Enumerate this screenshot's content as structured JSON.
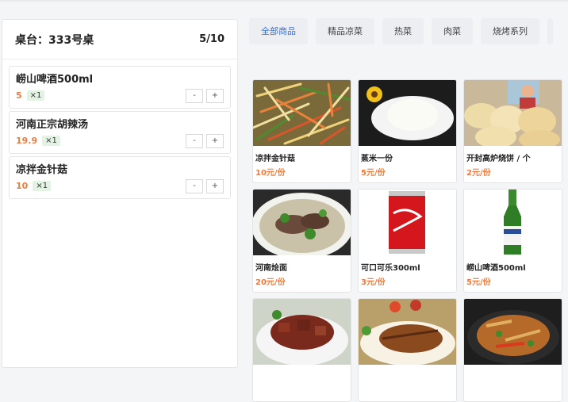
{
  "table": {
    "label": "桌台：333号桌",
    "count": "5/10"
  },
  "order_items": [
    {
      "name": "崂山啤酒500ml",
      "price": "5",
      "qty": "×1"
    },
    {
      "name": "河南正宗胡辣汤",
      "price": "19.9",
      "qty": "×1"
    },
    {
      "name": "凉拌金针菇",
      "price": "10",
      "qty": "×1"
    }
  ],
  "stepper": {
    "minus": "-",
    "plus": "+"
  },
  "tabs": [
    "全部商品",
    "精品凉菜",
    "热菜",
    "肉菜",
    "烧烤系列"
  ],
  "products": [
    {
      "name": "凉拌金针菇",
      "price": "10元/份"
    },
    {
      "name": "蒸米一份",
      "price": "5元/份"
    },
    {
      "name": "开封高炉烧饼 / 个",
      "price": "2元/份"
    },
    {
      "name": "河南烩面",
      "price": "20元/份"
    },
    {
      "name": "可口可乐300ml",
      "price": "3元/份"
    },
    {
      "name": "崂山啤酒500ml",
      "price": "5元/份"
    },
    {
      "name": "",
      "price": ""
    },
    {
      "name": "",
      "price": ""
    },
    {
      "name": "",
      "price": ""
    }
  ],
  "colors": {
    "accent": "#3a6fd8",
    "price": "#f07b3c",
    "qty_bg": "#e3f3e3"
  }
}
